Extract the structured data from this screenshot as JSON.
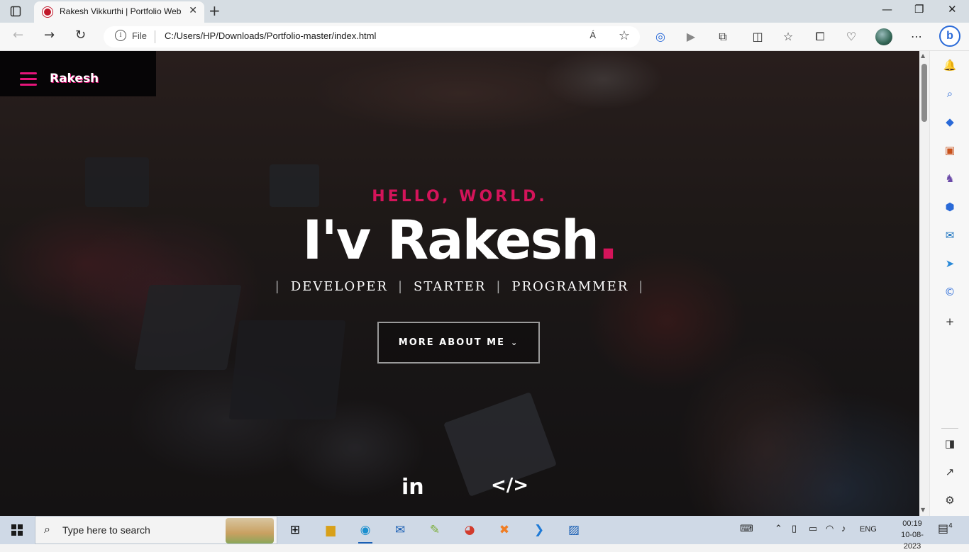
{
  "browser": {
    "tab_title": "Rakesh Vikkurthi | Portfolio Webs",
    "tab_close": "✕",
    "new_tab": "+",
    "window_controls": {
      "minimize": "—",
      "restore": "❐",
      "close": "✕"
    },
    "file_label": "File",
    "url": "C:/Users/HP/Downloads/Portfolio-master/index.html",
    "read_aloud": "Á",
    "icons": [
      "back-icon",
      "forward-icon",
      "refresh-icon",
      "info-icon",
      "read-aloud-icon",
      "favorite-star-icon",
      "tracking-icon",
      "play-icon",
      "extensions-icon",
      "split-screen-icon",
      "favorites-icon",
      "collections-icon",
      "performance-icon",
      "profile-icon",
      "more-icon",
      "bing-icon"
    ]
  },
  "page": {
    "brand": "Rakesh",
    "greeting": "HELLO, WORLD.",
    "name_main": "I'v Rakesh",
    "name_dot": ".",
    "roles": [
      "DEVELOPER",
      "STARTER",
      "PROGRAMMER"
    ],
    "cta": "MORE ABOUT ME",
    "social": {
      "linkedin": "in",
      "code": "</>"
    }
  },
  "taskbar": {
    "search_placeholder": "Type here to search",
    "language": "ENG",
    "time": "00:19",
    "date": "10-08-2023",
    "notification_count": "4",
    "apps": [
      "task-view",
      "file-explorer",
      "edge",
      "mail",
      "notepad-plus",
      "chrome",
      "xampp",
      "vscode",
      "photos"
    ]
  },
  "colors": {
    "accent": "#d4145a",
    "brand_pink": "#e5157a"
  }
}
